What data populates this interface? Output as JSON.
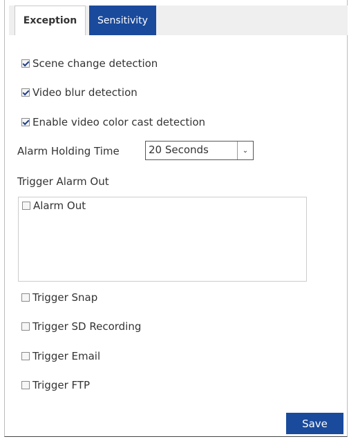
{
  "tabs": {
    "exception": "Exception",
    "sensitivity": "Sensitivity"
  },
  "options": [
    {
      "label": "Scene change detection",
      "checked": true
    },
    {
      "label": "Video blur detection",
      "checked": true
    },
    {
      "label": "Enable video color cast detection",
      "checked": true
    }
  ],
  "alarm_holding_time": {
    "label": "Alarm Holding Time",
    "value": "20 Seconds"
  },
  "trigger_alarm_out": {
    "label": "Trigger Alarm Out",
    "items": [
      {
        "label": "Alarm Out",
        "checked": false
      }
    ]
  },
  "triggers": [
    {
      "label": "Trigger Snap",
      "checked": false
    },
    {
      "label": "Trigger SD Recording",
      "checked": false
    },
    {
      "label": "Trigger Email",
      "checked": false
    },
    {
      "label": "Trigger FTP",
      "checked": false
    }
  ],
  "save_label": "Save"
}
